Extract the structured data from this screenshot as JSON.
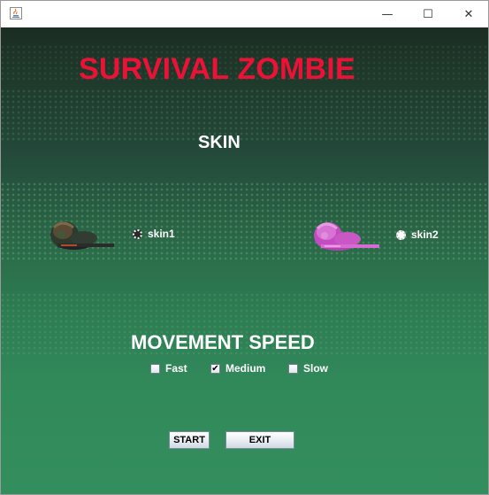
{
  "window": {
    "controls": {
      "minimize_glyph": "—",
      "maximize_glyph": "☐",
      "close_glyph": "✕"
    },
    "app_icon": "java-cup-icon"
  },
  "game": {
    "title": "SURVIVAL ZOMBIE",
    "title_color": "#ee1137",
    "skin_heading": "SKIN",
    "skins": [
      {
        "label": "skin1",
        "selected": false,
        "sprite": "soldier-dark-icon"
      },
      {
        "label": "skin2",
        "selected": true,
        "sprite": "soldier-pink-icon"
      }
    ],
    "speed_heading": "MOVEMENT SPEED",
    "speeds": [
      {
        "label": "Fast",
        "checked": false
      },
      {
        "label": "Medium",
        "checked": true
      },
      {
        "label": "Slow",
        "checked": false
      }
    ],
    "buttons": {
      "start": "START",
      "exit": "EXIT"
    }
  }
}
